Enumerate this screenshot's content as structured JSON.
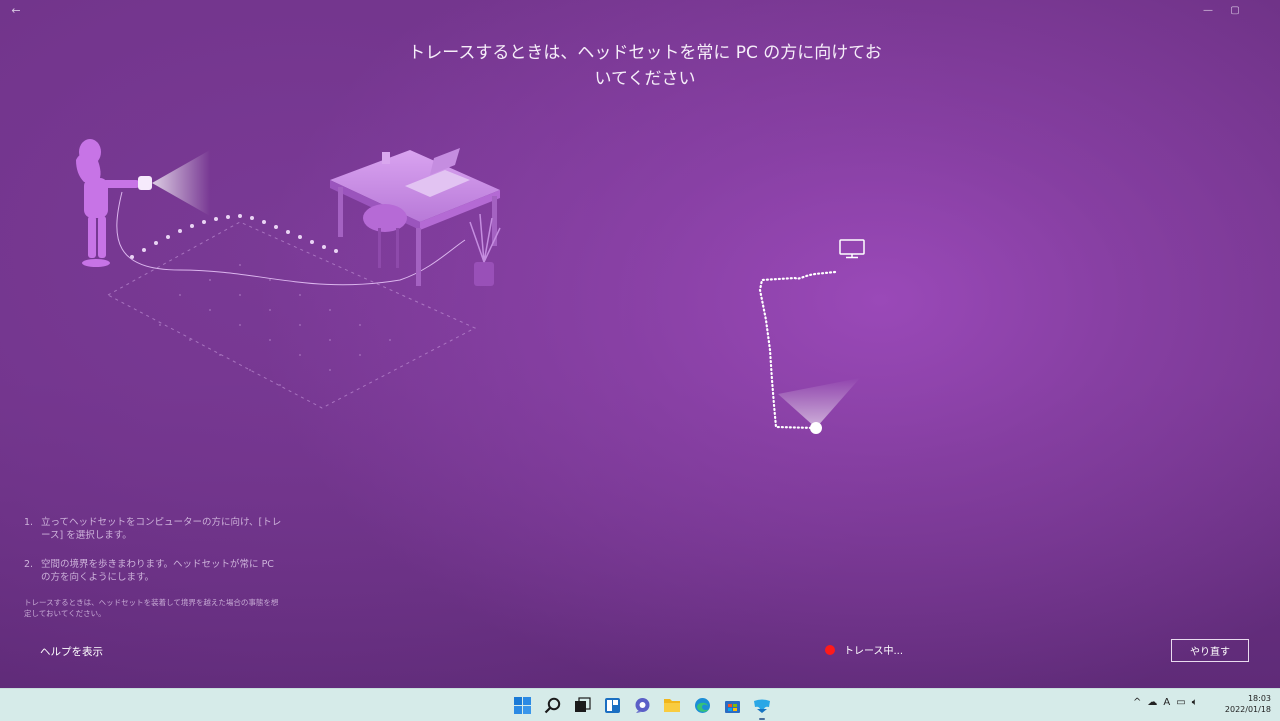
{
  "window": {
    "back_icon": "back-arrow-icon",
    "minimize_icon": "minimize-icon",
    "maximize_icon": "maximize-icon"
  },
  "headline": "トレースするときは、ヘッドセットを常に PC の方に向けておいてください",
  "instructions": {
    "steps": [
      {
        "number": "1.",
        "text": "立ってヘッドセットをコンピューターの方に向け、[トレース] を選択します。"
      },
      {
        "number": "2.",
        "text": "空間の境界を歩きまわります。ヘッドセットが常に PC の方を向くようにします。"
      }
    ],
    "note": "トレースするときは、ヘッドセットを装着して境界を越えた場合の事態を想定しておいてください。"
  },
  "help_link": "ヘルプを表示",
  "status": {
    "text": "トレース中...",
    "dot_color": "#ff1a1a"
  },
  "retry_button": "やり直す",
  "colors": {
    "background": "#7a3a96",
    "accent_highlight": "#9a49b8",
    "taskbar": "#d6ebe9"
  },
  "taskbar": {
    "apps": [
      {
        "name": "start-icon"
      },
      {
        "name": "search-icon"
      },
      {
        "name": "task-view-icon"
      },
      {
        "name": "widgets-icon"
      },
      {
        "name": "chat-icon"
      },
      {
        "name": "file-explorer-icon"
      },
      {
        "name": "edge-icon"
      },
      {
        "name": "store-icon"
      },
      {
        "name": "mixed-reality-portal-icon"
      }
    ],
    "tray": {
      "chevron": "^",
      "ime": "A"
    },
    "clock": {
      "time": "18:03",
      "date": "2022/01/18"
    }
  }
}
